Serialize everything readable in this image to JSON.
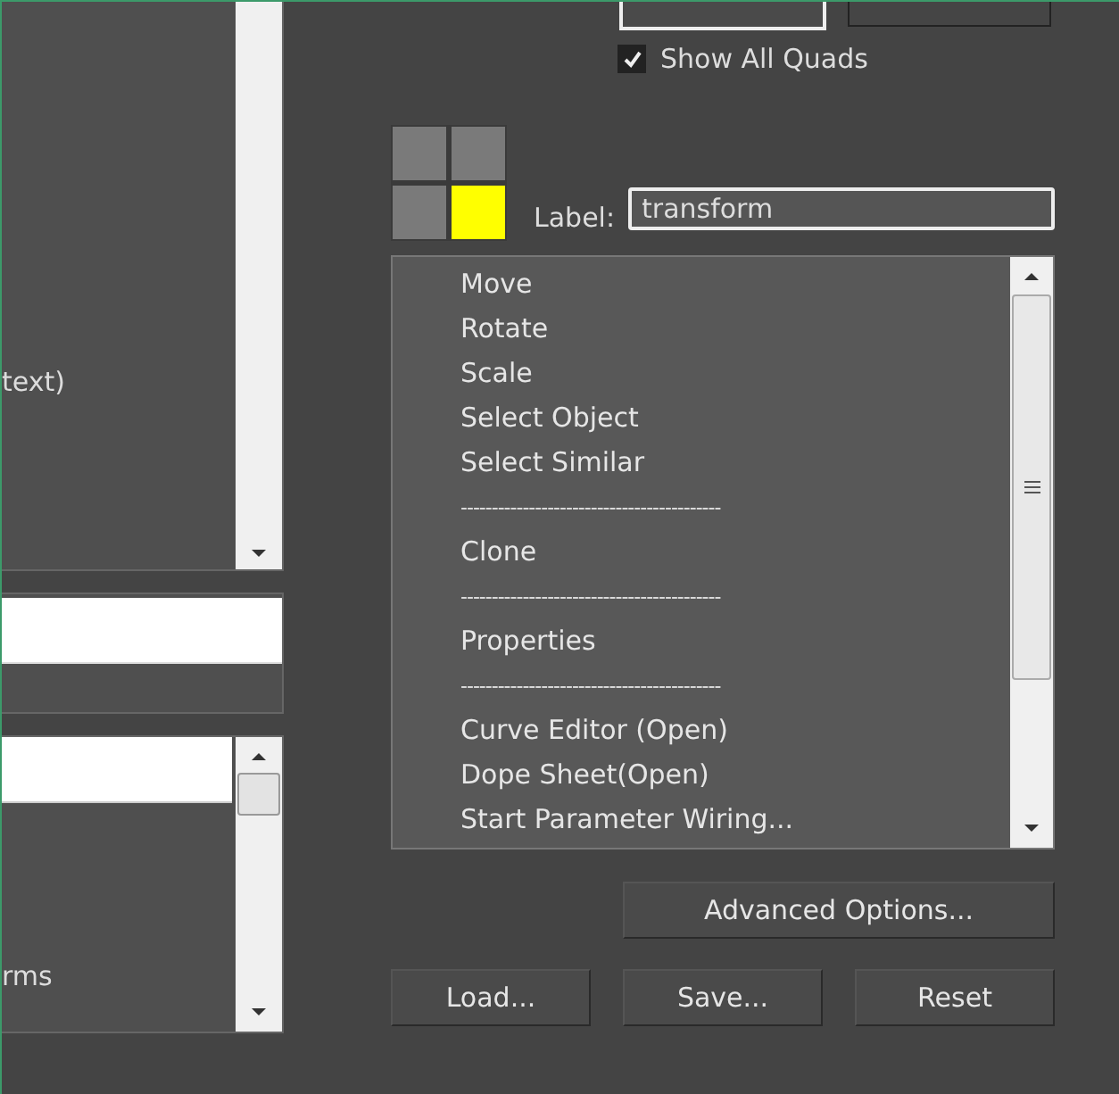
{
  "left_panels": [
    {
      "text": "text)"
    },
    {
      "text": "rms"
    }
  ],
  "show_all_quads": {
    "label": "Show All Quads",
    "checked": true
  },
  "quads": [
    {
      "selected": false
    },
    {
      "selected": false
    },
    {
      "selected": false
    },
    {
      "selected": true
    }
  ],
  "label_field": {
    "label": "Label:",
    "value": "transform"
  },
  "menu_items": [
    {
      "kind": "item",
      "text": "Move"
    },
    {
      "kind": "item",
      "text": "Rotate"
    },
    {
      "kind": "item",
      "text": "Scale"
    },
    {
      "kind": "item",
      "text": "Select Object"
    },
    {
      "kind": "item",
      "text": "Select Similar"
    },
    {
      "kind": "separator",
      "text": "------------------------------------------"
    },
    {
      "kind": "item",
      "text": "Clone"
    },
    {
      "kind": "separator",
      "text": "------------------------------------------"
    },
    {
      "kind": "item",
      "text": "Properties"
    },
    {
      "kind": "separator",
      "text": "------------------------------------------"
    },
    {
      "kind": "item",
      "text": "Curve Editor (Open)"
    },
    {
      "kind": "item",
      "text": "Dope Sheet(Open)"
    },
    {
      "kind": "item",
      "text": "Start Parameter Wiring..."
    }
  ],
  "advanced_button": "Advanced Options...",
  "buttons": [
    "Load...",
    "Save...",
    "Reset"
  ]
}
